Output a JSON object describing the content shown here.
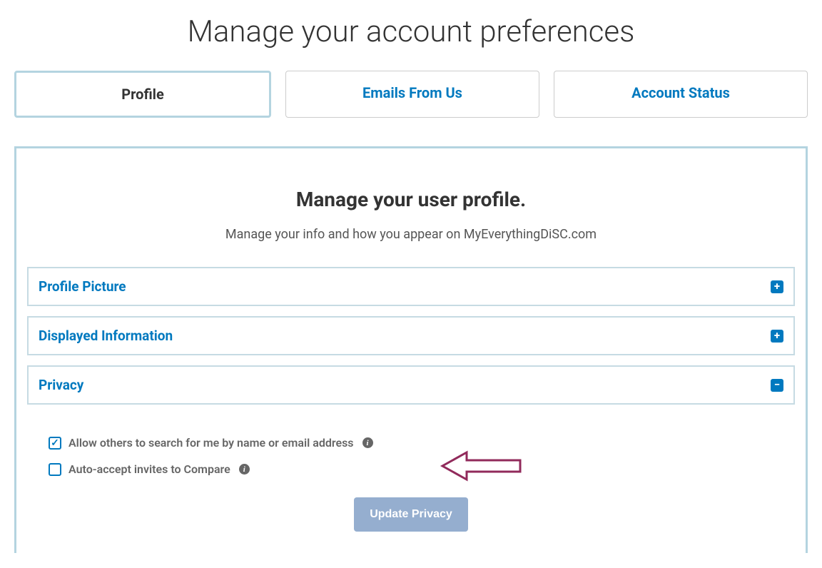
{
  "page_title": "Manage your account preferences",
  "tabs": [
    {
      "label": "Profile",
      "active": true
    },
    {
      "label": "Emails From Us",
      "active": false
    },
    {
      "label": "Account Status",
      "active": false
    }
  ],
  "section": {
    "title": "Manage your user profile.",
    "subtitle": "Manage your info and how you appear on MyEverythingDiSC.com"
  },
  "accordions": {
    "profile_picture": {
      "label": "Profile Picture",
      "expanded": false
    },
    "displayed_information": {
      "label": "Displayed Information",
      "expanded": false
    },
    "privacy": {
      "label": "Privacy",
      "expanded": true
    }
  },
  "privacy": {
    "allow_search": {
      "label": "Allow others to search for me by name or email address",
      "checked": true
    },
    "auto_accept": {
      "label": "Auto-accept invites to Compare",
      "checked": false
    },
    "update_button": "Update Privacy"
  },
  "colors": {
    "accent": "#0079bf",
    "panel_border": "#b4d4e0"
  }
}
